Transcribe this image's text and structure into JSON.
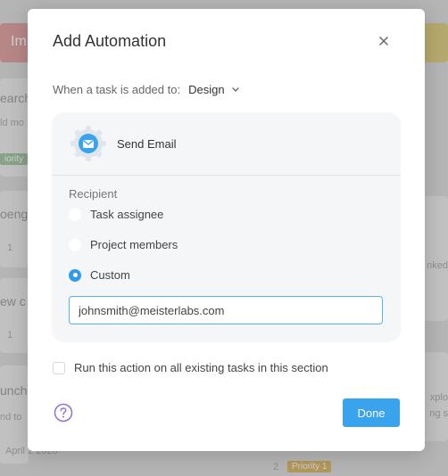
{
  "modal": {
    "title": "Add Automation",
    "trigger_prefix": "When a task is added to:",
    "trigger_section": "Design",
    "action_label": "Send Email",
    "recipient_label": "Recipient",
    "recipient_options": [
      {
        "label": "Task assignee",
        "checked": false
      },
      {
        "label": "Project members",
        "checked": false
      },
      {
        "label": "Custom",
        "checked": true
      }
    ],
    "email_value": "johnsmith@meisterlabs.com",
    "existing_tasks_label": "Run this action on all existing tasks in this section",
    "done_label": "Done"
  },
  "background": {
    "left_texts": [
      "Im",
      "earch",
      "ld mo",
      "iority",
      "oeng",
      "1",
      "ew c",
      "1",
      "unch",
      "nd to",
      "April 2 2020"
    ],
    "right_texts": [
      "nked",
      "xplo",
      "ng s",
      "2",
      "Priority 1"
    ]
  },
  "colors": {
    "accent": "#3aa3ee",
    "radio_checked": "#2f9bea",
    "panel": "#f5f6f8",
    "help_icon": "#8e6fe0"
  }
}
